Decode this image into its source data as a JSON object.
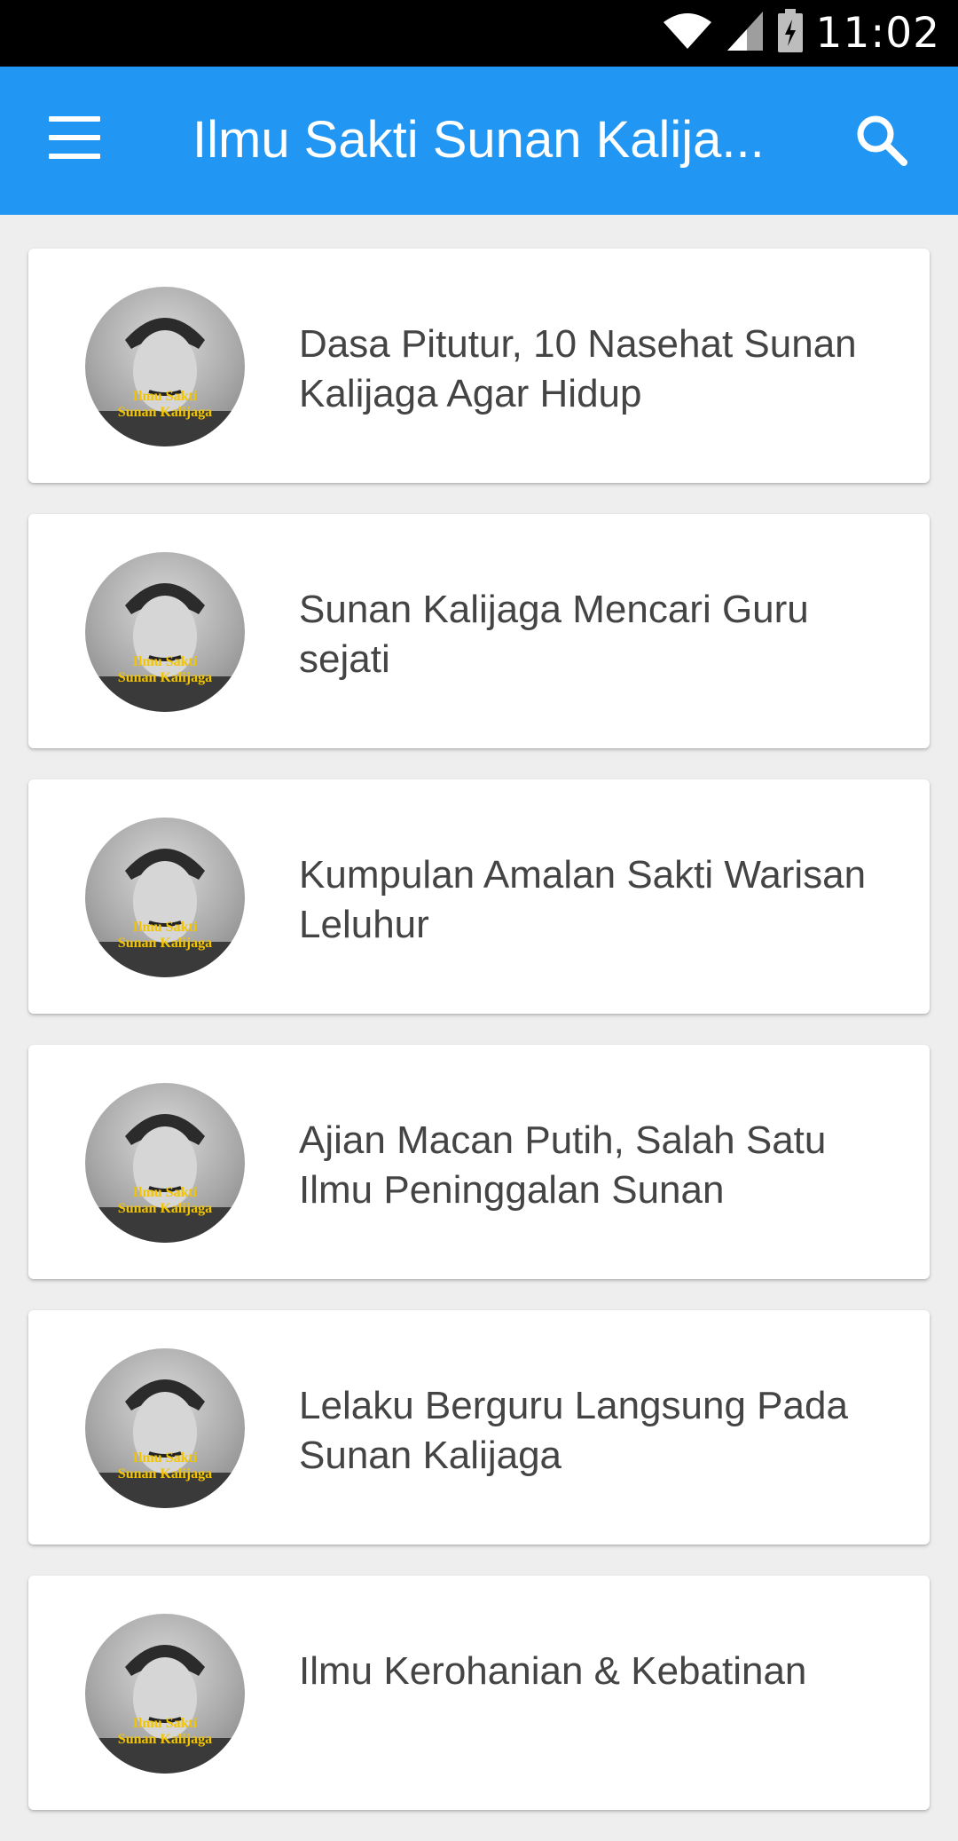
{
  "status_bar": {
    "time": "11:02"
  },
  "app_bar": {
    "title": "Ilmu Sakti Sunan Kalija..."
  },
  "thumbnail_caption": [
    "Ilmu Sakti",
    "Sunan Kalijaga"
  ],
  "items": [
    {
      "title": "Dasa Pitutur, 10 Nasehat Sunan Kalijaga Agar Hidup"
    },
    {
      "title": "Sunan Kalijaga Mencari Guru sejati"
    },
    {
      "title": "Kumpulan Amalan Sakti Warisan Leluhur"
    },
    {
      "title": "Ajian Macan Putih, Salah Satu Ilmu Peninggalan Sunan"
    },
    {
      "title": "Lelaku Berguru Langsung Pada Sunan Kalijaga"
    },
    {
      "title": "Ilmu Kerohanian & Kebatinan"
    }
  ],
  "colors": {
    "primary": "#2196f3",
    "background": "#eeeeee",
    "text": "#444444"
  }
}
